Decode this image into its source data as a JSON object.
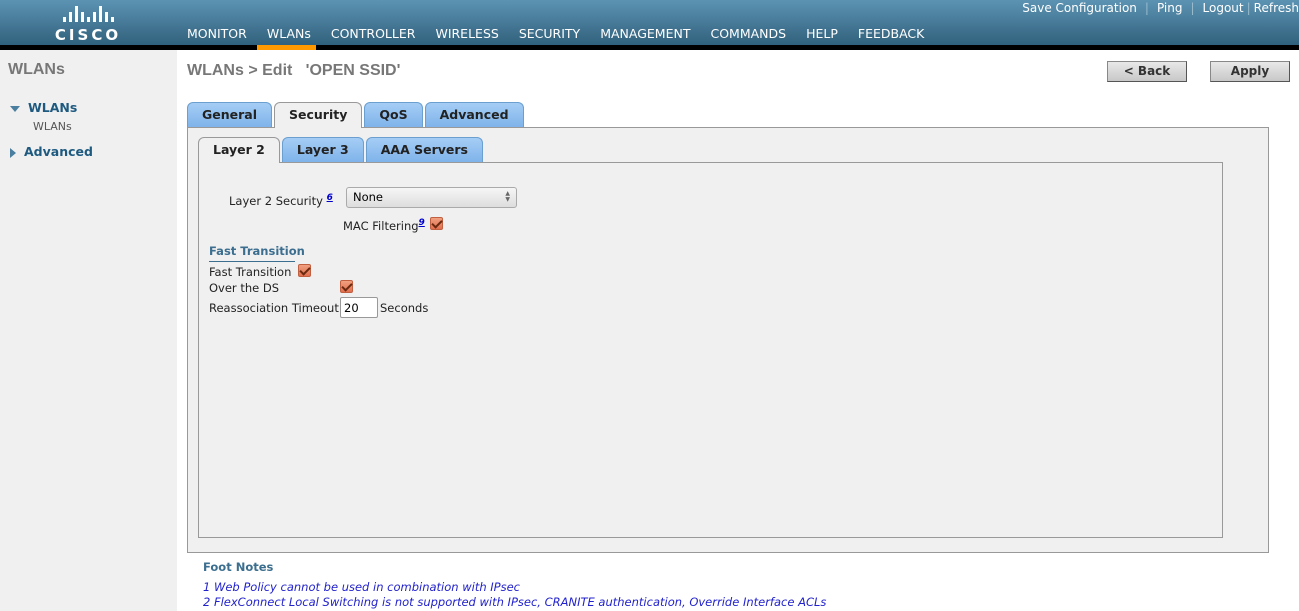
{
  "header": {
    "logo": "CISCO",
    "nav": [
      "MONITOR",
      "WLANs",
      "CONTROLLER",
      "WIRELESS",
      "SECURITY",
      "MANAGEMENT",
      "COMMANDS",
      "HELP",
      "FEEDBACK"
    ],
    "active_nav": "WLANs",
    "top_links": [
      "Save Configuration",
      "Ping",
      "Logout",
      "Refresh"
    ],
    "accent": "#ff9900"
  },
  "sidebar": {
    "title": "WLANs",
    "groups": [
      {
        "label": "WLANs",
        "expanded": true,
        "items": [
          "WLANs"
        ]
      },
      {
        "label": "Advanced",
        "expanded": false
      }
    ]
  },
  "page": {
    "title": "WLANs > Edit   'OPEN SSID'",
    "back": "< Back",
    "apply": "Apply"
  },
  "tabs": [
    "General",
    "Security",
    "QoS",
    "Advanced"
  ],
  "subtabs": [
    "Layer 2",
    "Layer 3",
    "AAA Servers"
  ],
  "form": {
    "l2_label": "Layer 2 Security",
    "l2_fn": "6",
    "l2_value": "None",
    "mac_label": "MAC Filtering",
    "mac_fn": "9",
    "mac_checked": true,
    "ft_heading": "Fast Transition",
    "ft_label": "Fast Transition",
    "ft_checked": true,
    "ds_label": "Over the DS",
    "ds_checked": true,
    "reassoc_label": "Reassociation Timeout",
    "reassoc_value": "20",
    "reassoc_unit": "Seconds"
  },
  "footnotes": {
    "heading": "Foot Notes",
    "items": [
      "1 Web Policy cannot be used in combination with IPsec",
      "2 FlexConnect Local Switching is not supported with IPsec, CRANITE authentication, Override Interface ACLs"
    ]
  }
}
